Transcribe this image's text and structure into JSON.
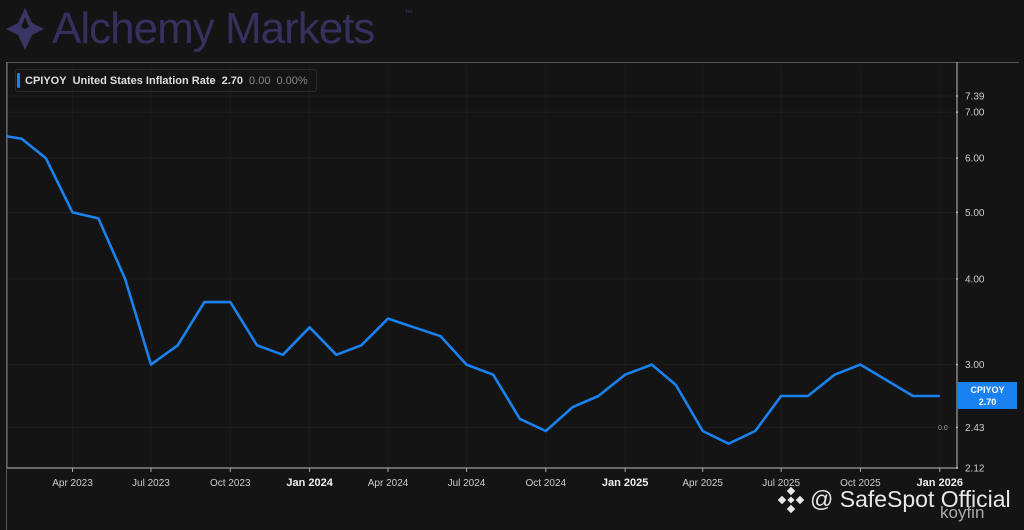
{
  "brand": {
    "name": "Alchemy Markets",
    "trademark": "™",
    "color": "#35305e"
  },
  "legend": {
    "ticker": "CPIYOY",
    "name": "United States Inflation Rate",
    "last": "2.70",
    "change": "0.00",
    "change_pct": "0.00%",
    "color": "#1a82f0"
  },
  "price_tag": {
    "ticker": "CPIYOY",
    "value": "2.70"
  },
  "zero_label": "0.0",
  "watermark": {
    "text": "@ SafeSpot Official",
    "icon": "binance-icon",
    "koyfin": "koyfin"
  },
  "chart_data": {
    "type": "line",
    "title": "",
    "xlabel": "",
    "ylabel": "",
    "y_scale": "log",
    "ylim": [
      2.12,
      7.39
    ],
    "xlim": [
      "2023-01-15",
      "2026-01-21"
    ],
    "grid": true,
    "y_ticks": [
      "7.39",
      "7.00",
      "6.00",
      "5.00",
      "4.00",
      "3.00",
      "2.43",
      "2.12"
    ],
    "x_ticks": [
      {
        "date": "2023-04-01",
        "label": "Apr 2023",
        "bold": false
      },
      {
        "date": "2023-07-01",
        "label": "Jul 2023",
        "bold": false
      },
      {
        "date": "2023-10-01",
        "label": "Oct 2023",
        "bold": false
      },
      {
        "date": "2024-01-01",
        "label": "Jan 2024",
        "bold": true
      },
      {
        "date": "2024-04-01",
        "label": "Apr 2024",
        "bold": false
      },
      {
        "date": "2024-07-01",
        "label": "Jul 2024",
        "bold": false
      },
      {
        "date": "2024-10-01",
        "label": "Oct 2024",
        "bold": false
      },
      {
        "date": "2025-01-01",
        "label": "Jan 2025",
        "bold": true
      },
      {
        "date": "2025-04-01",
        "label": "Apr 2025",
        "bold": false
      },
      {
        "date": "2025-07-01",
        "label": "Jul 2025",
        "bold": false
      },
      {
        "date": "2025-10-01",
        "label": "Oct 2025",
        "bold": false
      },
      {
        "date": "2026-01-01",
        "label": "Jan 2026",
        "bold": true
      }
    ],
    "series": [
      {
        "name": "CPIYOY",
        "color": "#1a82f0",
        "points": [
          [
            "2023-01-01",
            6.5
          ],
          [
            "2023-02-01",
            6.4
          ],
          [
            "2023-03-01",
            6.0
          ],
          [
            "2023-04-01",
            5.0
          ],
          [
            "2023-05-01",
            4.9
          ],
          [
            "2023-06-01",
            4.0
          ],
          [
            "2023-07-01",
            3.0
          ],
          [
            "2023-08-01",
            3.2
          ],
          [
            "2023-09-01",
            3.7
          ],
          [
            "2023-10-01",
            3.7
          ],
          [
            "2023-11-01",
            3.2
          ],
          [
            "2023-12-01",
            3.1
          ],
          [
            "2024-01-01",
            3.4
          ],
          [
            "2024-02-01",
            3.1
          ],
          [
            "2024-03-01",
            3.2
          ],
          [
            "2024-04-01",
            3.5
          ],
          [
            "2024-05-01",
            3.4
          ],
          [
            "2024-06-01",
            3.3
          ],
          [
            "2024-07-01",
            3.0
          ],
          [
            "2024-08-01",
            2.9
          ],
          [
            "2024-09-01",
            2.5
          ],
          [
            "2024-10-01",
            2.4
          ],
          [
            "2024-11-01",
            2.6
          ],
          [
            "2024-12-01",
            2.7
          ],
          [
            "2025-01-01",
            2.9
          ],
          [
            "2025-02-01",
            3.0
          ],
          [
            "2025-03-01",
            2.8
          ],
          [
            "2025-04-01",
            2.4
          ],
          [
            "2025-05-01",
            2.3
          ],
          [
            "2025-06-01",
            2.4
          ],
          [
            "2025-07-01",
            2.7
          ],
          [
            "2025-08-01",
            2.7
          ],
          [
            "2025-09-01",
            2.9
          ],
          [
            "2025-10-01",
            3.0
          ],
          [
            "2025-12-01",
            2.7
          ],
          [
            "2026-01-01",
            2.7
          ]
        ]
      }
    ]
  }
}
